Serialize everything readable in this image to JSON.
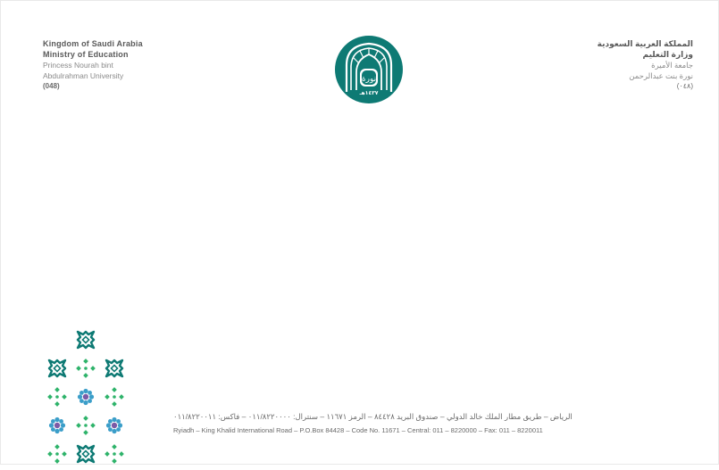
{
  "header": {
    "en": {
      "line1": "Kingdom of Saudi Arabia",
      "line2": "Ministry of Education",
      "line3": "Princess Nourah bint",
      "line4": "Abdulrahman University",
      "line5": "(048)"
    },
    "ar": {
      "line1": "المملكة العربية السعودية",
      "line2": "وزارة التعليم",
      "line3": "جامعة الأميرة",
      "line4": "نورة بنت عبدالرحمن",
      "line5": "(٠٤٨)"
    }
  },
  "logo": {
    "icon": "university-emblem-icon",
    "wordmark": "نورة",
    "year": "١٤٣٧هـ",
    "color": "#0e7a74"
  },
  "footer": {
    "ar": "الرياض – طريق مطار الملك خالد الدولي – صندوق البريد ٨٤٤٢٨ – الرمز ١١٦٧١ – سنترال: ٠١١/٨٢٢٠٠٠٠ – فاكس: ٠١١/٨٢٢٠٠١١",
    "en": "Ryiadh – King Khalid International Road – P.O.Box 84428 – Code No. 11671 – Central: 011 – 8220000 – Fax: 011 – 8220011"
  },
  "colors": {
    "teal": "#0e7a74",
    "green": "#2fb36b",
    "blue": "#3b9ec9",
    "purple": "#7b5aa6",
    "text": "#6a6a6a"
  }
}
